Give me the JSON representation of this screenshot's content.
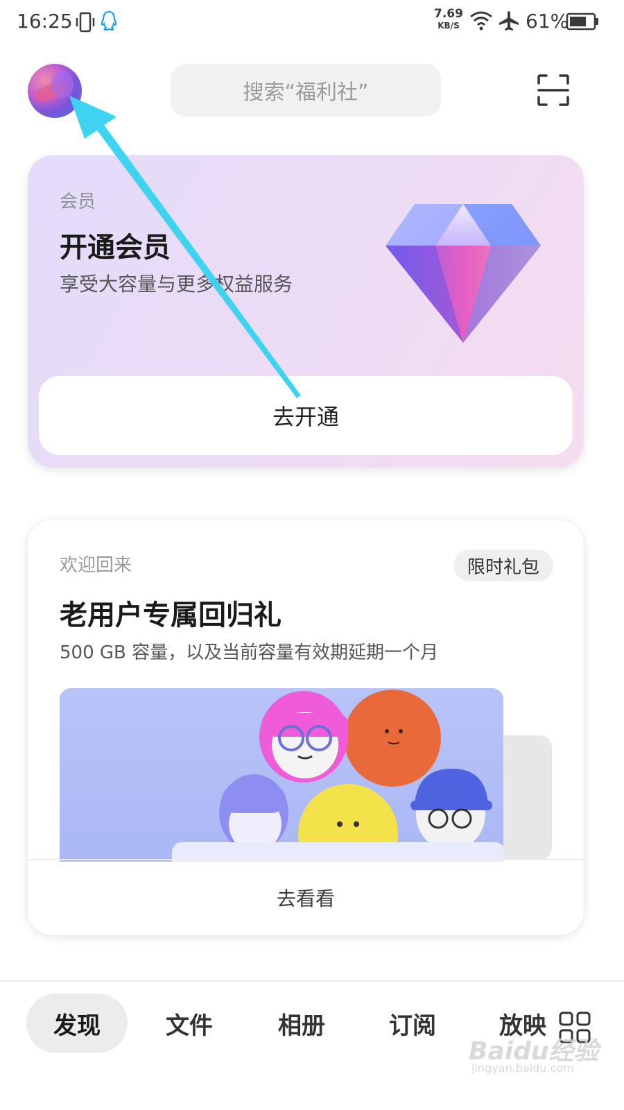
{
  "status_bar": {
    "time": "16:25",
    "net_speed_value": "7.69",
    "net_speed_unit": "KB/S",
    "battery": "61%"
  },
  "header": {
    "search_placeholder": "搜索“福利社”"
  },
  "member_card": {
    "label": "会员",
    "title": "开通会员",
    "subtitle": "享受大容量与更多权益服务",
    "button": "去开通"
  },
  "welcome_card": {
    "label": "欢迎回来",
    "badge": "限时礼包",
    "title": "老用户专属回归礼",
    "subtitle": "500 GB 容量，以及当前容量有效期延期一个月",
    "action": "去看看"
  },
  "bottom_nav": {
    "tabs": [
      "发现",
      "文件",
      "相册",
      "订阅",
      "放映"
    ]
  },
  "watermark": {
    "brand": "Baidu经验",
    "url": "jingyan.baidu.com"
  },
  "colors": {
    "arrow": "#3fd3f2",
    "member_gradient_start": "#e3dcfa",
    "member_gradient_end": "#f6dcef"
  }
}
